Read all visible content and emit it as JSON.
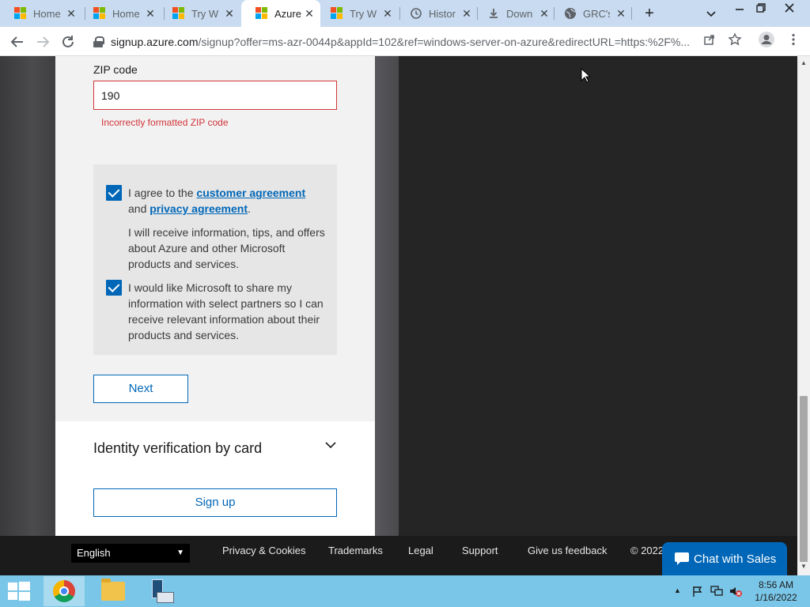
{
  "browser": {
    "tabs": [
      {
        "title": "Home",
        "icon": "microsoft-logo-icon",
        "active": false
      },
      {
        "title": "Home",
        "icon": "microsoft-logo-icon",
        "active": false
      },
      {
        "title": "Try Wi",
        "icon": "microsoft-logo-icon",
        "active": false
      },
      {
        "title": "Azure",
        "icon": "microsoft-logo-icon",
        "active": true
      },
      {
        "title": "Try Wi",
        "icon": "microsoft-logo-icon",
        "active": false
      },
      {
        "title": "Histor",
        "icon": "history-icon",
        "active": false
      },
      {
        "title": "Downl",
        "icon": "download-icon",
        "active": false
      },
      {
        "title": "GRC's",
        "icon": "globe-icon",
        "active": false
      }
    ],
    "close_glyph": "✕",
    "new_tab_glyph": "+",
    "url_host": "signup.azure.com",
    "url_rest": "/signup?offer=ms-azr-0044p&appId=102&ref=windows-server-on-azure&redirectURL=https:%2F%..."
  },
  "form": {
    "zip_label": "ZIP code",
    "zip_value": "190",
    "zip_error": "Incorrectly formatted ZIP code",
    "agree_prefix": "I agree to the ",
    "customer_agreement": "customer agreement",
    "agree_and": "and ",
    "privacy_agreement": "privacy agreement",
    "agree_suffix": ".",
    "info_text": "I will receive information, tips, and offers about Azure and other Microsoft products and services.",
    "share_text": "I would like Microsoft to share my information with select partners so I can receive relevant information about their products and services.",
    "next_label": "Next",
    "identity_title": "Identity verification by card",
    "signup_label": "Sign up"
  },
  "footer": {
    "language": "English",
    "links": [
      "Privacy & Cookies",
      "Trademarks",
      "Legal",
      "Support",
      "Give us feedback",
      "© 2022"
    ],
    "chat_label": "Chat with Sales"
  },
  "taskbar": {
    "time": "8:56 AM",
    "date": "1/16/2022"
  },
  "colors": {
    "accent": "#0067b8",
    "error": "#d13438",
    "taskbar": "#7ac6e8"
  }
}
